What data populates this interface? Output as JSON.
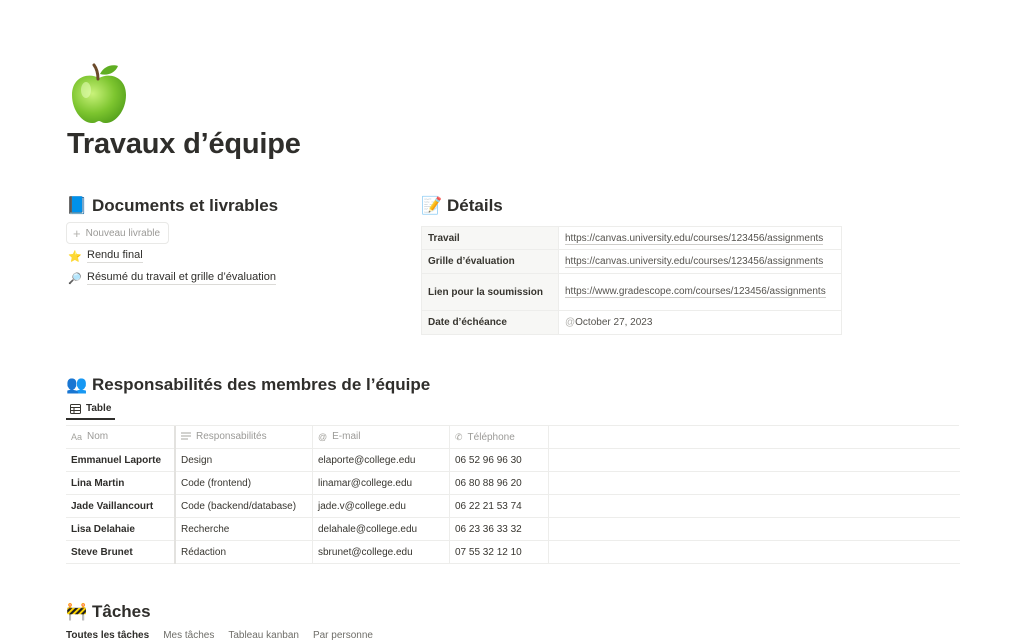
{
  "page": {
    "icon": "green-apple-icon",
    "title": "Travaux d’équipe"
  },
  "documents": {
    "icon": "blue-book-icon",
    "heading": "Documents et livrables",
    "new_button": "Nouveau livrable",
    "items": [
      {
        "icon": "star-icon",
        "label": "Rendu final"
      },
      {
        "icon": "magnifier-icon",
        "label": "Résumé du travail et grille d’évaluation"
      }
    ]
  },
  "details": {
    "icon": "memo-icon",
    "heading": "Détails",
    "rows": [
      {
        "key": "Travail",
        "value": "https://canvas.university.edu/courses/123456/assignments"
      },
      {
        "key": "Grille d’évaluation",
        "value": "https://canvas.university.edu/courses/123456/assignments"
      },
      {
        "key": "Lien pour la soumission",
        "value": "https://www.gradescope.com/courses/123456/assignments"
      },
      {
        "key": "Date d’échéance",
        "prefix": "@",
        "value": "October 27, 2023"
      }
    ]
  },
  "members": {
    "icon": "people-icon",
    "heading": "Responsabilités des membres de l’équipe",
    "tab": "Table",
    "columns": [
      {
        "icon": "Aa",
        "label": "Nom"
      },
      {
        "icon": "text-lines-icon",
        "label": "Responsabilités"
      },
      {
        "icon": "@",
        "label": "E-mail"
      },
      {
        "icon": "phone-icon",
        "label": "Téléphone"
      }
    ],
    "rows": [
      [
        "Emmanuel Laporte",
        "Design",
        "elaporte@college.edu",
        "06 52 96 96 30"
      ],
      [
        "Lina Martin",
        "Code (frontend)",
        "linamar@college.edu",
        "06 80 88 96 20"
      ],
      [
        "Jade Vaillancourt",
        "Code (backend/database)",
        "jade.v@college.edu",
        "06 22 21 53 74"
      ],
      [
        "Lisa Delahaie",
        "Recherche",
        "delahale@college.edu",
        "06 23 36 33 32"
      ],
      [
        "Steve Brunet",
        "Rédaction",
        "sbrunet@college.edu",
        "07 55 32 12 10"
      ]
    ]
  },
  "tasks": {
    "icon": "construction-icon",
    "heading": "Tâches",
    "views": [
      "Toutes les tâches",
      "Mes tâches",
      "Tableau kanban",
      "Par personne"
    ]
  }
}
